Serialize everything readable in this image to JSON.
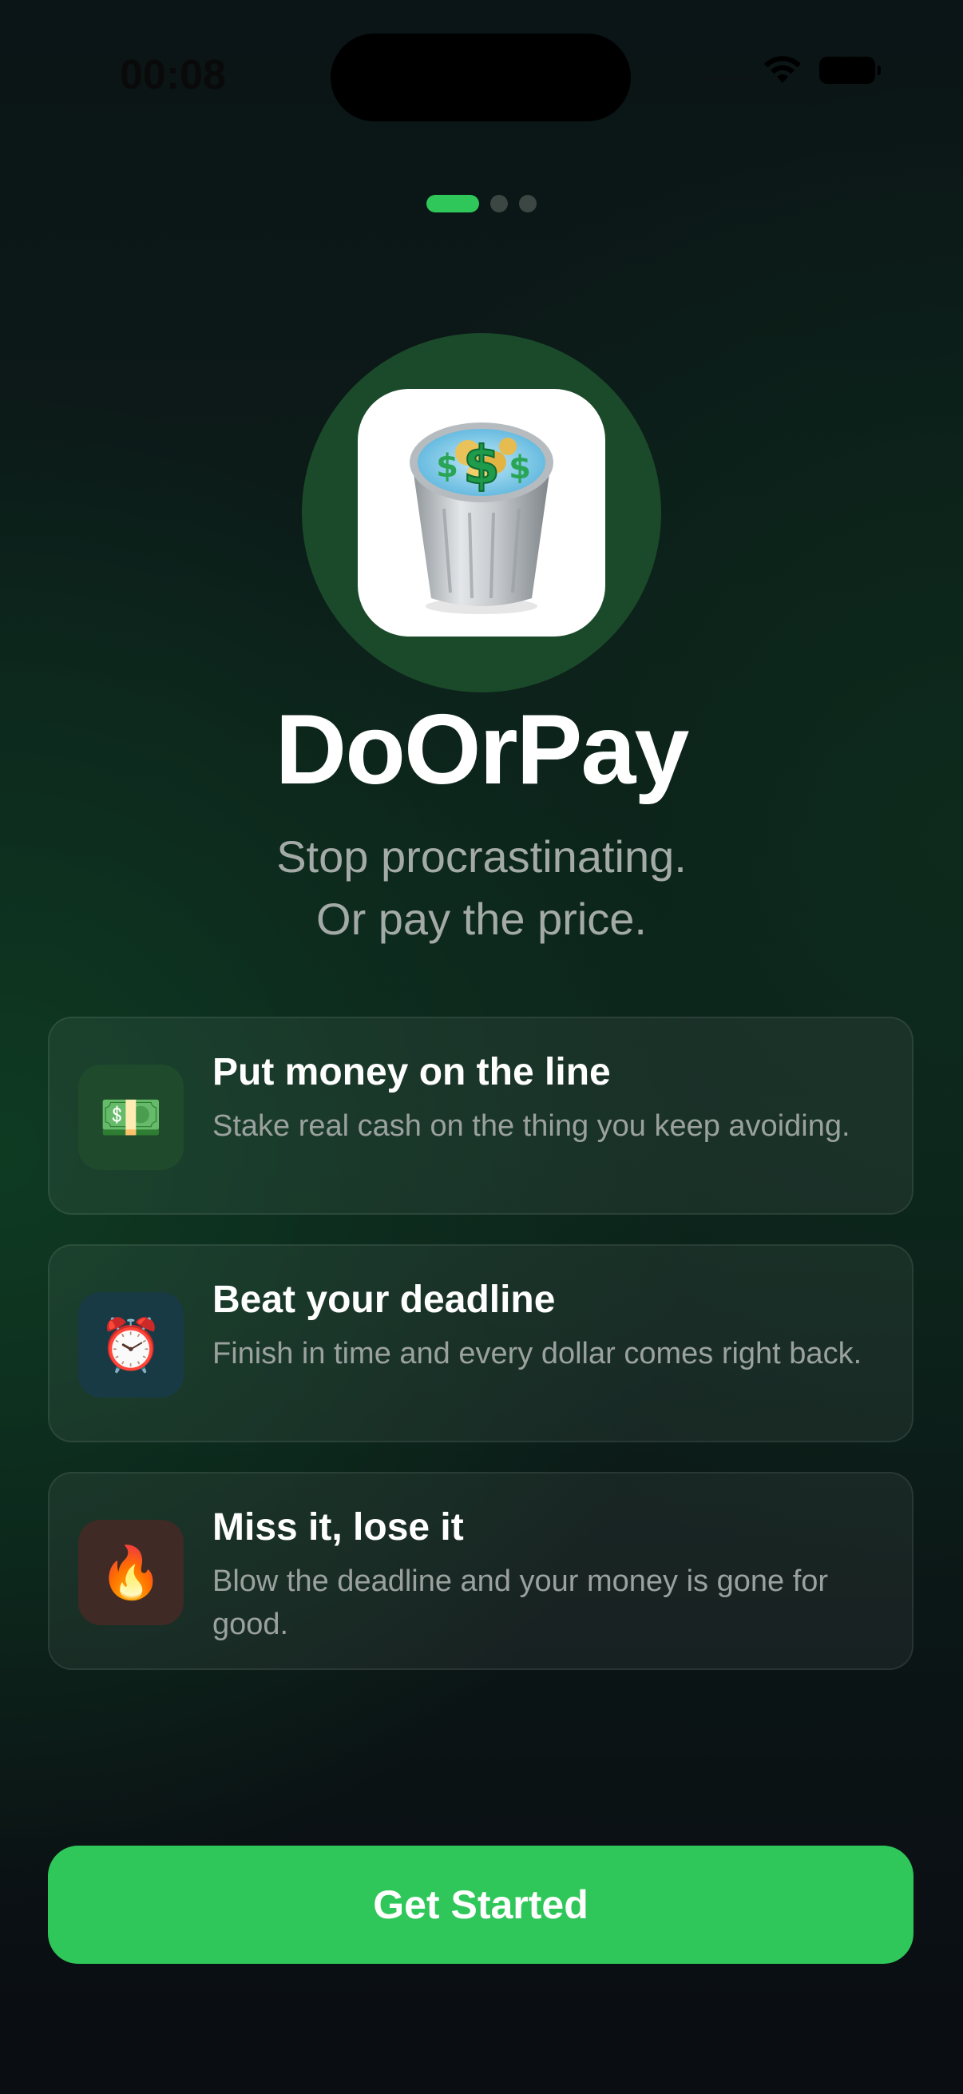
{
  "status_bar": {
    "time": "00:08"
  },
  "pager": {
    "total": 3,
    "current": 1
  },
  "app": {
    "name": "DoOrPay",
    "tagline_line1": "Stop procrastinating.",
    "tagline_line2": "Or pay the price."
  },
  "features": [
    {
      "icon": "money-bills-icon",
      "glyph": "💵",
      "title": "Put money on the line",
      "description": "Stake real cash on the thing you keep avoiding.",
      "icon_bg": "#1f4a2c"
    },
    {
      "icon": "alarm-clock-icon",
      "glyph": "⏰",
      "title": "Beat your deadline",
      "description": "Finish in time and every dollar comes right back.",
      "icon_bg": "#183a44"
    },
    {
      "icon": "fire-icon",
      "glyph": "🔥",
      "title": "Miss it, lose it",
      "description": "Blow the deadline and your money is gone for good.",
      "icon_bg": "#3f2a25"
    }
  ],
  "cta": {
    "label": "Get Started"
  },
  "colors": {
    "accent": "#30c75a",
    "logo_ring": "#1b4a2a"
  }
}
